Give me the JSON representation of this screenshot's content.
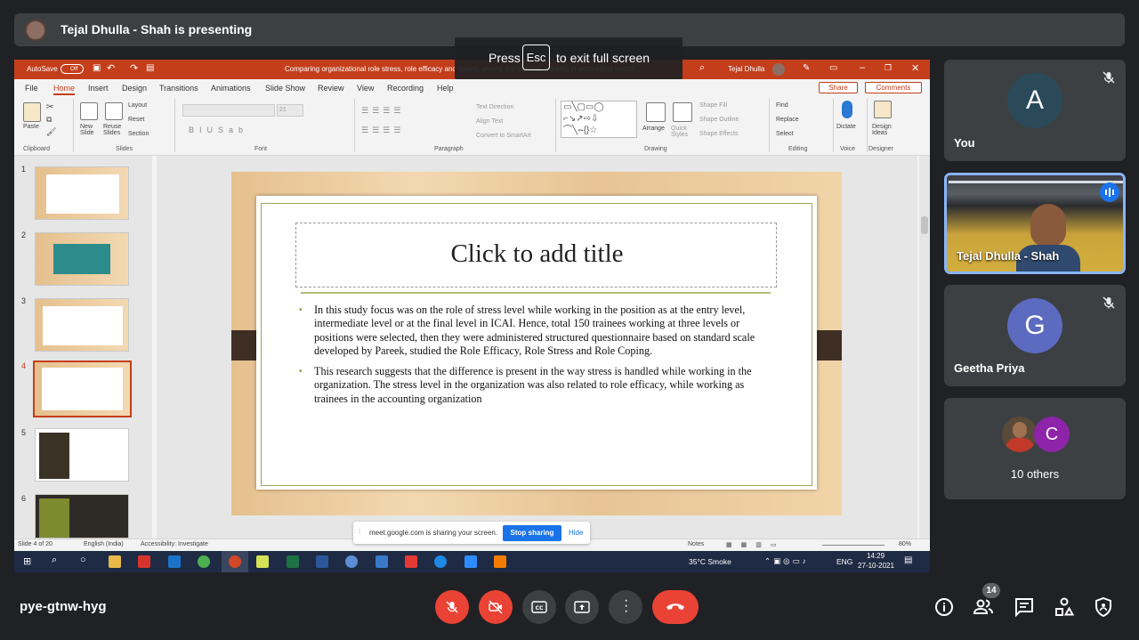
{
  "presenter_bar": {
    "text": "Tejal Dhulla - Shah is presenting"
  },
  "fullscreen_toast": {
    "press": "Press",
    "key": "Esc",
    "rest": "to exit full screen"
  },
  "powerpoint": {
    "autosave": "AutoSave",
    "autosave_state": "Off",
    "doc_title": "Comparing organizational role stress, role efficacy and coping among the trainees working in accounting sector",
    "user": "Tejal Dhulla",
    "menu": [
      "File",
      "Home",
      "Insert",
      "Design",
      "Transitions",
      "Animations",
      "Slide Show",
      "Review",
      "View",
      "Recording",
      "Help"
    ],
    "share": "Share",
    "comments": "Comments",
    "ribbon": {
      "paste": "Paste",
      "new_slide": "New Slide",
      "reuse_slides": "Reuse Slides",
      "layout": "Layout",
      "reset": "Reset",
      "section": "Section",
      "font_size": "21",
      "text_direction": "Text Direction",
      "align_text": "Align Text",
      "convert_smartart": "Convert to SmartArt",
      "arrange": "Arrange",
      "quick_styles": "Quick Styles",
      "shape_fill": "Shape Fill",
      "shape_outline": "Shape Outline",
      "shape_effects": "Shape Effects",
      "find": "Find",
      "replace": "Replace",
      "select": "Select",
      "dictate": "Dictate",
      "design_ideas": "Design Ideas",
      "groups": [
        "Clipboard",
        "Slides",
        "Font",
        "Paragraph",
        "Drawing",
        "Editing",
        "Voice",
        "Designer"
      ]
    },
    "thumb_numbers": [
      "1",
      "2",
      "3",
      "4",
      "5",
      "6"
    ],
    "slide": {
      "title": "Click to add title",
      "bullets": [
        "In this study focus was on the role of stress level while working in the position as at the entry level, intermediate level or at the final level in ICAI. Hence, total 150 trainees working at three levels or positions were selected, then they were administered structured questionnaire based on standard scale developed by Pareek, studied the Role Efficacy, Role Stress and Role Coping.",
        "This research suggests that the difference is present in the way stress is  handled while working in the organization. The stress level in the organization was also related to role efficacy, while working as trainees in the accounting organization"
      ]
    },
    "status": {
      "slide": "Slide 4 of 20",
      "language": "English (India)",
      "accessibility": "Accessibility: Investigate",
      "notes": "Notes",
      "zoom": "80%"
    },
    "taskbar": {
      "weather": "35°C  Smoke",
      "lang": "ENG",
      "time": "14:29",
      "date": "27-10-2021"
    }
  },
  "share_bar": {
    "text": "meet.google.com is sharing your screen.",
    "stop": "Stop sharing",
    "hide": "Hide"
  },
  "participants": [
    {
      "initial": "A",
      "name": "You",
      "color": "#2a4a5a"
    },
    {
      "name": "Tejal Dhulla - Shah"
    },
    {
      "initial": "G",
      "name": "Geetha Priya",
      "color": "#5c6bc0"
    },
    {
      "initial": "C",
      "name": "10 others",
      "color": "#8e24aa"
    }
  ],
  "meeting": {
    "code": "pye-gtnw-hyg",
    "participant_count": "14"
  }
}
